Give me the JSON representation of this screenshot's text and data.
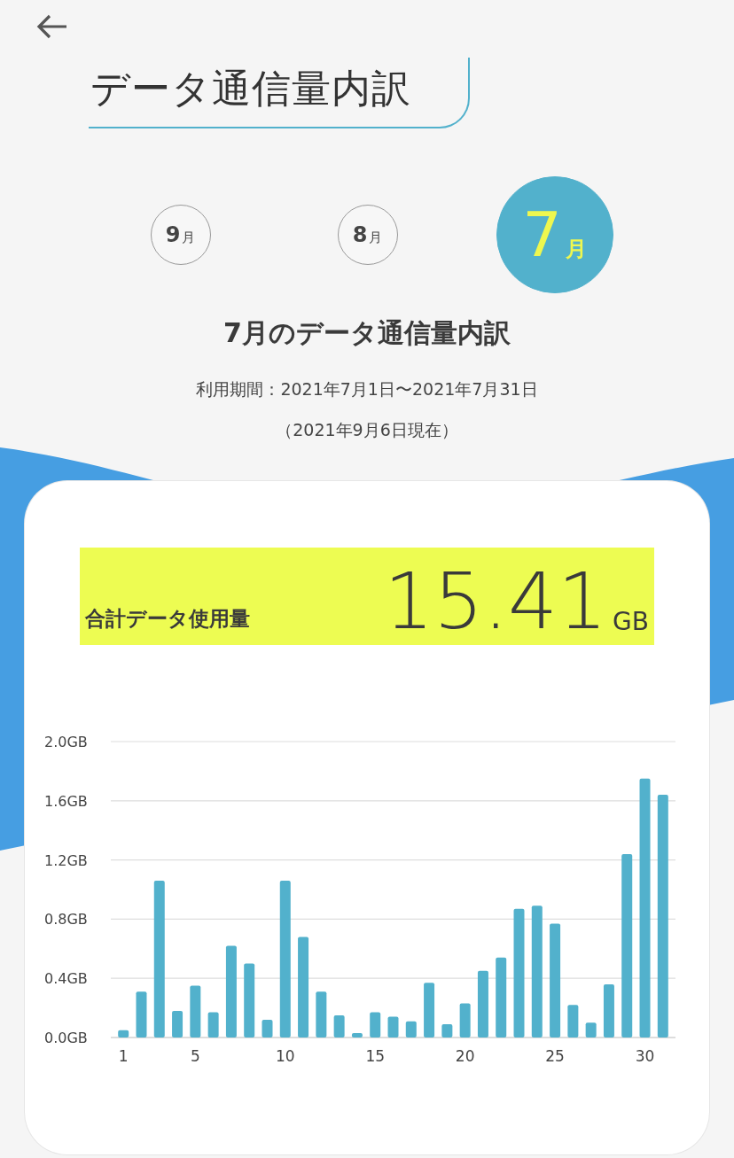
{
  "header": {
    "title": "データ通信量内訳"
  },
  "months": [
    {
      "number": "9",
      "unit": "月",
      "selected": false
    },
    {
      "number": "8",
      "unit": "月",
      "selected": false
    },
    {
      "number": "7",
      "unit": "月",
      "selected": true
    }
  ],
  "period": {
    "heading": "7月のデータ通信量内訳",
    "range": "利用期間：2021年7月1日〜2021年7月31日",
    "as_of": "（2021年9月6日現在）"
  },
  "total": {
    "label": "合計データ使用量",
    "value": "15.41",
    "unit": "GB"
  },
  "chart_data": {
    "type": "bar",
    "grid": true,
    "x": [
      1,
      2,
      3,
      4,
      5,
      6,
      7,
      8,
      9,
      10,
      11,
      12,
      13,
      14,
      15,
      16,
      17,
      18,
      19,
      20,
      21,
      22,
      23,
      24,
      25,
      26,
      27,
      28,
      29,
      30,
      31
    ],
    "series": [
      {
        "color": "#52b1cc",
        "values": [
          0.05,
          0.31,
          1.06,
          0.18,
          0.35,
          0.17,
          0.62,
          0.5,
          0.12,
          1.06,
          0.68,
          0.31,
          0.15,
          0.03,
          0.17,
          0.14,
          0.11,
          0.37,
          0.09,
          0.23,
          0.45,
          0.54,
          0.87,
          0.89,
          0.77,
          0.22,
          0.1,
          0.36,
          1.24,
          1.75,
          1.64
        ]
      }
    ],
    "xlim": [
      0.3,
      31.7
    ],
    "ylim": [
      0,
      2
    ],
    "yticks": [
      {
        "value": 0,
        "label": "0.0GB"
      },
      {
        "value": 0.4,
        "label": "0.4GB"
      },
      {
        "value": 0.8,
        "label": "0.8GB"
      },
      {
        "value": 1.2,
        "label": "1.2GB"
      },
      {
        "value": 1.6,
        "label": "1.6GB"
      },
      {
        "value": 2,
        "label": "2.0GB"
      }
    ],
    "xticks": [
      {
        "value": 1,
        "label": "1"
      },
      {
        "value": 5,
        "label": "5"
      },
      {
        "value": 10,
        "label": "10"
      },
      {
        "value": 15,
        "label": "15"
      },
      {
        "value": 20,
        "label": "20"
      },
      {
        "value": 25,
        "label": "25"
      },
      {
        "value": 30,
        "label": "30"
      }
    ]
  }
}
